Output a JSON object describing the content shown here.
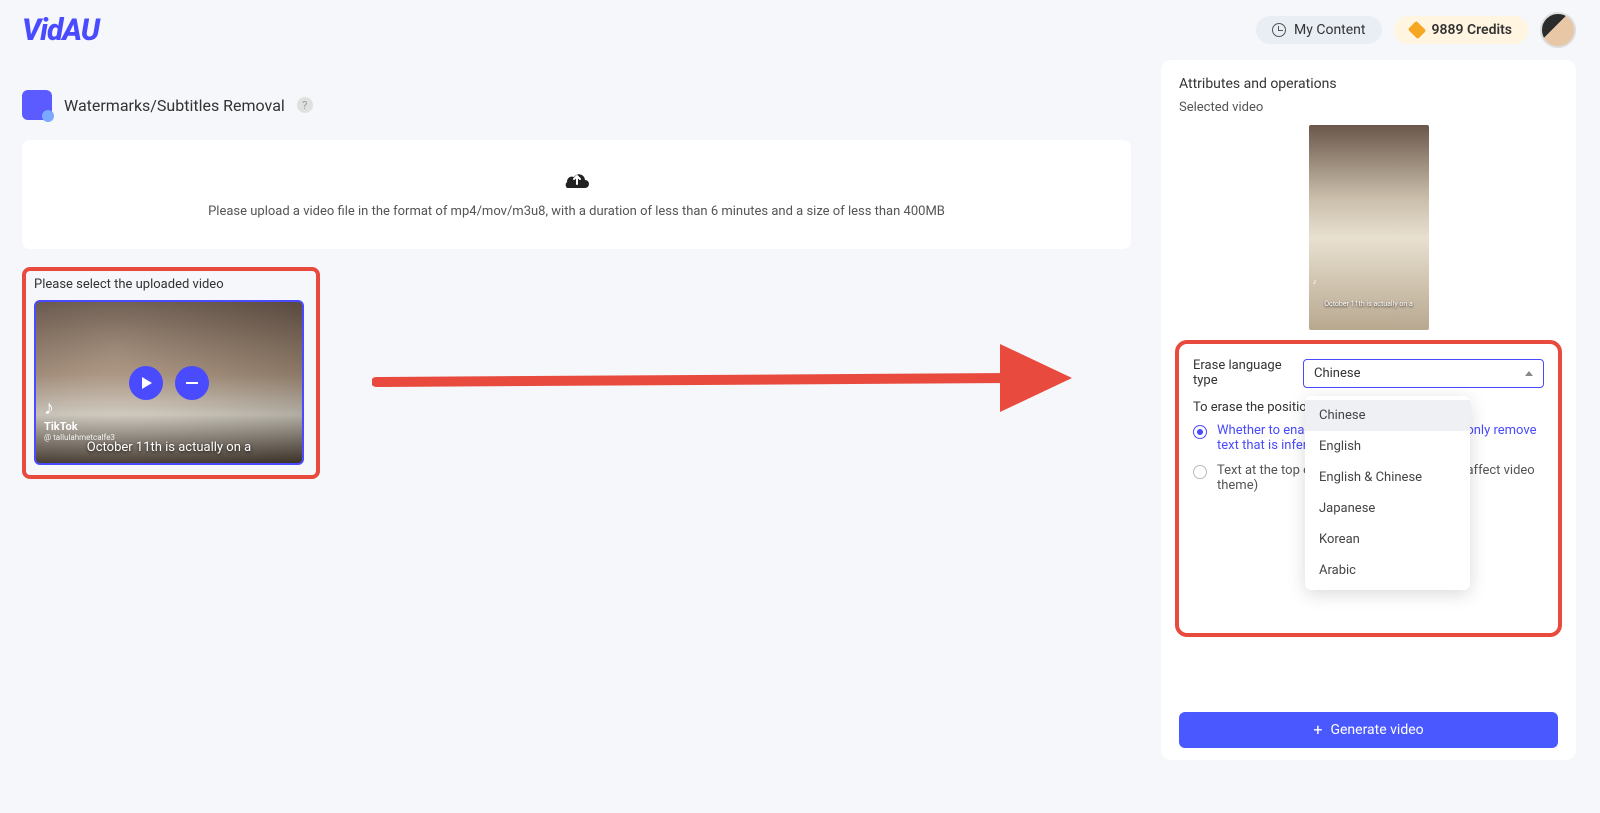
{
  "header": {
    "logo": "VidAU",
    "my_content": "My Content",
    "credits": "9889 Credits"
  },
  "page": {
    "title": "Watermarks/Subtitles Removal",
    "help": "?"
  },
  "upload": {
    "instructions": "Please upload a video file in the format of mp4/mov/m3u8, with a duration of less than 6 minutes and a size of less than 400MB"
  },
  "select": {
    "label": "Please select the uploaded video",
    "tiktok_brand": "TikTok",
    "tiktok_handle": "@ tallulahmetcalfe3",
    "caption": "October 11th is actually on a"
  },
  "right_panel": {
    "attributes": "Attributes and operations",
    "selected_video": "Selected video",
    "preview_caption": "October 11th is actually on a",
    "erase_lang_label": "Erase language type",
    "erase_lang_value": "Chinese",
    "erase_position_label": "To erase the position",
    "option1": "Whether to enable subtitle recognition (will only remove text that is inferred to be subtitles)",
    "option2": "Text at the top or bottom of the video (may affect video theme)",
    "generate": "Generate video"
  },
  "dropdown": {
    "options": [
      "Chinese",
      "English",
      "English & Chinese",
      "Japanese",
      "Korean",
      "Arabic"
    ],
    "selected": "Chinese"
  }
}
